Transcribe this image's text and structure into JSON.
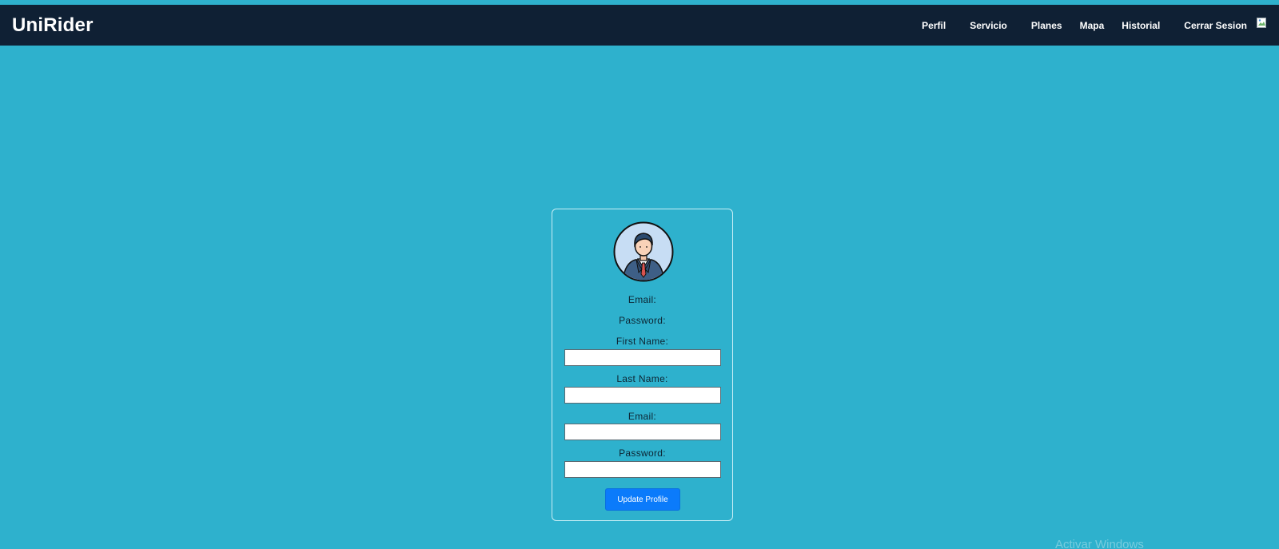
{
  "app": {
    "brand": "UniRider"
  },
  "nav": {
    "items": [
      {
        "label": "Perfil"
      },
      {
        "label": "Servicio"
      },
      {
        "label": "Planes"
      },
      {
        "label": "Mapa"
      },
      {
        "label": "Historial"
      },
      {
        "label": "Cerrar Sesion"
      }
    ],
    "profile_image_icon": "broken-image-icon"
  },
  "profile": {
    "avatar_icon": "businessman-avatar-icon",
    "display_email_label": "Email:",
    "display_password_label": "Password:",
    "first_name_label": "First Name:",
    "first_name_value": "",
    "last_name_label": "Last Name:",
    "last_name_value": "",
    "email_label": "Email:",
    "email_value": "",
    "password_label": "Password:",
    "password_value": "",
    "update_button": "Update Profile"
  },
  "watermark": "Activar Windows",
  "colors": {
    "background": "#2eb1cd",
    "navbar": "#0f2034",
    "button": "#0b7bfb",
    "text_dark": "#0d2533"
  }
}
